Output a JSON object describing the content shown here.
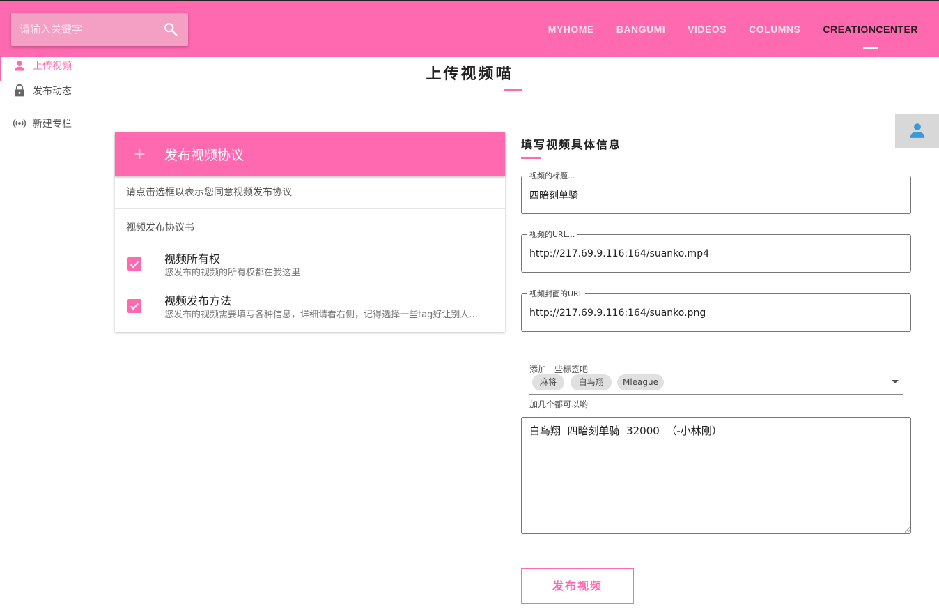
{
  "search": {
    "placeholder": "请输入关键字"
  },
  "nav": {
    "items": [
      {
        "label": "MYHOME"
      },
      {
        "label": "BANGUMI"
      },
      {
        "label": "VIDEOS"
      },
      {
        "label": "COLUMNS"
      },
      {
        "label": "CREATIONCENTER",
        "active": true
      }
    ]
  },
  "sidebar": {
    "items": [
      {
        "label": "上传视频",
        "icon": "person-icon",
        "active": true
      },
      {
        "label": "发布动态",
        "icon": "lock-icon"
      },
      {
        "label": "新建专栏",
        "icon": "broadcast-icon"
      }
    ]
  },
  "page": {
    "title": "上传视频喵"
  },
  "agreement": {
    "plus": "+",
    "title": "发布视频协议",
    "hint": "请点击选框以表示您同意视频发布协议",
    "subheader": "视频发布协议书",
    "items": [
      {
        "title": "视频所有权",
        "desc": "您发布的视频的所有权都在我这里",
        "checked": true
      },
      {
        "title": "视频发布方法",
        "desc": "您发布的视频需要填写各种信息，详细请看右侧，记得选择一些tag好让别人...",
        "checked": true
      }
    ]
  },
  "form": {
    "title": "填写视频具体信息",
    "video_title": {
      "label": "视频的标题...",
      "value": "四暗刻单骑"
    },
    "video_url": {
      "label": "视频的URL...",
      "value": "http://217.69.9.116:164/suanko.mp4"
    },
    "cover_url": {
      "label": "视频封面的URL",
      "value": "http://217.69.9.116:164/suanko.png"
    },
    "tags": {
      "label": "添加一些标签吧",
      "chips": [
        "麻将",
        "白鸟翔",
        "Mleague"
      ],
      "hint": "加几个都可以哟"
    },
    "description": "白鸟翔  四暗刻单骑  32000  （-小林刚）",
    "submit": "发布视频"
  },
  "colors": {
    "accent": "#ff69b0",
    "float_icon": "#3a9ad9"
  }
}
